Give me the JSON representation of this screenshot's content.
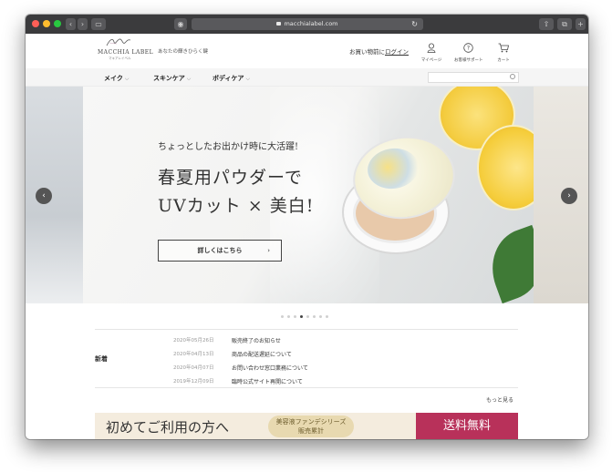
{
  "browser": {
    "url": "macchialabel.com",
    "colors": {
      "toolbar": "#3b3b3d",
      "close": "#ff5f57",
      "minimize": "#febc2e",
      "zoom": "#28c840"
    }
  },
  "header": {
    "logo_script": "ℓℓ",
    "logo_text": "MACCHIA LABEL",
    "logo_sub": "マキアレイベル",
    "tagline": "あなたの輝きひらく鍵",
    "login_prefix": "お買い物前に",
    "login_link": "ログイン",
    "mypage_label": "マイページ",
    "support_label": "お客様サポート",
    "cart_label": "カート"
  },
  "nav": {
    "items": [
      {
        "label": "メイク"
      },
      {
        "label": "スキンケア"
      },
      {
        "label": "ボディケア"
      }
    ],
    "search_placeholder": ""
  },
  "hero": {
    "line_small": "ちょっとしたお出かけ時に大活躍!",
    "line_big1": "春夏用パウダーで",
    "line_big2": "UVカット × 美白!",
    "button_label": "詳しくはこちら",
    "slide_count": 8,
    "active_slide": 4
  },
  "news": {
    "title": "新着",
    "items": [
      {
        "date": "2020年05月26日",
        "text": "販売終了のお知らせ"
      },
      {
        "date": "2020年04月13日",
        "text": "商品の配送遅延について"
      },
      {
        "date": "2020年04月07日",
        "text": "お問い合わせ窓口業務について"
      },
      {
        "date": "2019年12月09日",
        "text": "臨時公式サイト再開について"
      }
    ],
    "more_label": "もっと見る"
  },
  "banner": {
    "text": "初めてご利用の方へ",
    "badge_line1": "美容液ファンデシリーズ",
    "badge_line2": "販売累計",
    "red_text": "送料無料",
    "accent_color": "#b8315a"
  }
}
